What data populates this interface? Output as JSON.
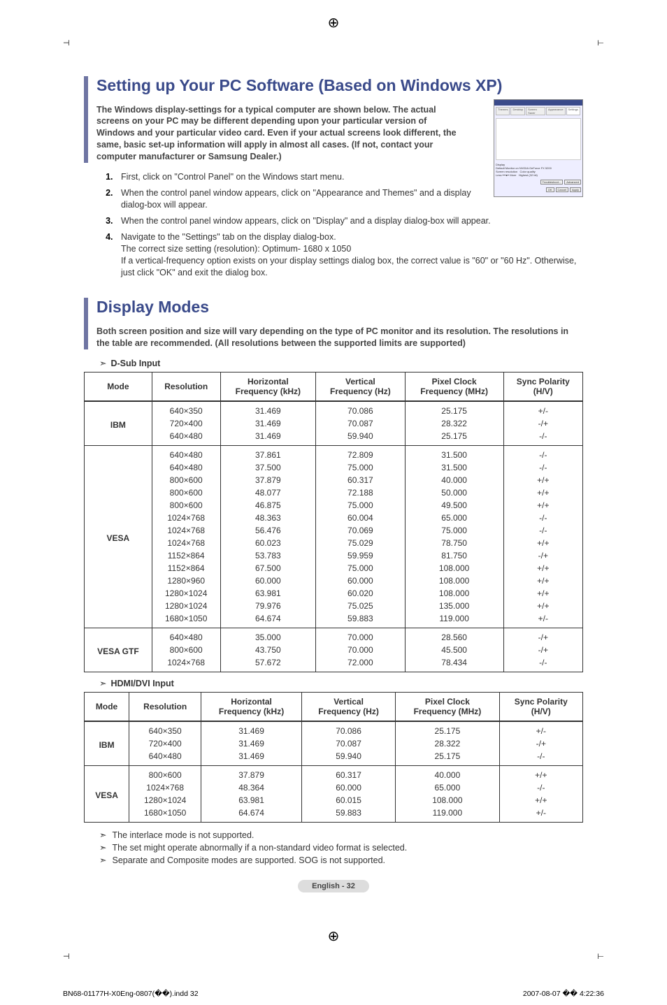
{
  "section1": {
    "title": "Setting up Your PC Software (Based on Windows XP)",
    "intro": "The Windows display-settings for a typical computer are shown below. The actual screens on your PC may be different depending upon your particular version of Windows and your particular video card. Even if your actual screens look different, the same, basic set-up information will apply in almost all cases. (If not, contact your computer manufacturer or Samsung Dealer.)",
    "steps": [
      "First, click on \"Control Panel\" on the Windows start menu.",
      "When the control panel window appears, click on \"Appearance and Themes\" and a display dialog-box will appear.",
      "When the control panel window appears, click on \"Display\" and a display dialog-box will appear.",
      "Navigate to the \"Settings\" tab on the display dialog-box.\nThe correct size setting (resolution): Optimum- 1680 x 1050\nIf a vertical-frequency option exists on your display settings dialog box, the correct value is \"60\" or \"60 Hz\". Otherwise, just click \"OK\" and exit the dialog box."
    ]
  },
  "section2": {
    "title": "Display Modes",
    "intro": "Both screen position and size will vary depending on the type of PC monitor and its resolution. The resolutions in the table are recommended. (All resolutions between the supported limits are supported)",
    "table_headers": [
      "Mode",
      "Resolution",
      "Horizontal Frequency (kHz)",
      "Vertical Frequency (Hz)",
      "Pixel Clock Frequency (MHz)",
      "Sync Polarity (H/V)"
    ],
    "dsub_label": "D-Sub Input",
    "hdmi_label": "HDMI/DVI Input",
    "dsub_groups": [
      {
        "mode": "IBM",
        "rows": [
          [
            "640×350",
            "31.469",
            "70.086",
            "25.175",
            "+/-"
          ],
          [
            "720×400",
            "31.469",
            "70.087",
            "28.322",
            "-/+"
          ],
          [
            "640×480",
            "31.469",
            "59.940",
            "25.175",
            "-/-"
          ]
        ]
      },
      {
        "mode": "VESA",
        "rows": [
          [
            "640×480",
            "37.861",
            "72.809",
            "31.500",
            "-/-"
          ],
          [
            "640×480",
            "37.500",
            "75.000",
            "31.500",
            "-/-"
          ],
          [
            "800×600",
            "37.879",
            "60.317",
            "40.000",
            "+/+"
          ],
          [
            "800×600",
            "48.077",
            "72.188",
            "50.000",
            "+/+"
          ],
          [
            "800×600",
            "46.875",
            "75.000",
            "49.500",
            "+/+"
          ],
          [
            "1024×768",
            "48.363",
            "60.004",
            "65.000",
            "-/-"
          ],
          [
            "1024×768",
            "56.476",
            "70.069",
            "75.000",
            "-/-"
          ],
          [
            "1024×768",
            "60.023",
            "75.029",
            "78.750",
            "+/+"
          ],
          [
            "1152×864",
            "53.783",
            "59.959",
            "81.750",
            "-/+"
          ],
          [
            "1152×864",
            "67.500",
            "75.000",
            "108.000",
            "+/+"
          ],
          [
            "1280×960",
            "60.000",
            "60.000",
            "108.000",
            "+/+"
          ],
          [
            "1280×1024",
            "63.981",
            "60.020",
            "108.000",
            "+/+"
          ],
          [
            "1280×1024",
            "79.976",
            "75.025",
            "135.000",
            "+/+"
          ],
          [
            "1680×1050",
            "64.674",
            "59.883",
            "119.000",
            "+/-"
          ]
        ]
      },
      {
        "mode": "VESA GTF",
        "rows": [
          [
            "640×480",
            "35.000",
            "70.000",
            "28.560",
            "-/+"
          ],
          [
            "800×600",
            "43.750",
            "70.000",
            "45.500",
            "-/+"
          ],
          [
            "1024×768",
            "57.672",
            "72.000",
            "78.434",
            "-/-"
          ]
        ]
      }
    ],
    "hdmi_groups": [
      {
        "mode": "IBM",
        "rows": [
          [
            "640×350",
            "31.469",
            "70.086",
            "25.175",
            "+/-"
          ],
          [
            "720×400",
            "31.469",
            "70.087",
            "28.322",
            "-/+"
          ],
          [
            "640×480",
            "31.469",
            "59.940",
            "25.175",
            "-/-"
          ]
        ]
      },
      {
        "mode": "VESA",
        "rows": [
          [
            "800×600",
            "37.879",
            "60.317",
            "40.000",
            "+/+"
          ],
          [
            "1024×768",
            "48.364",
            "60.000",
            "65.000",
            "-/-"
          ],
          [
            "1280×1024",
            "63.981",
            "60.015",
            "108.000",
            "+/+"
          ],
          [
            "1680×1050",
            "64.674",
            "59.883",
            "119.000",
            "+/-"
          ]
        ]
      }
    ],
    "notes": [
      "The interlace mode is not supported.",
      "The set might operate abnormally if a non-standard video format is selected.",
      "Separate and Composite modes are supported. SOG is not supported."
    ]
  },
  "page_footer": "English - 32",
  "doc_footer_left": "BN68-01177H-X0Eng-0807(��).indd   32",
  "doc_footer_right": "2007-08-07   �� 4:22:36"
}
